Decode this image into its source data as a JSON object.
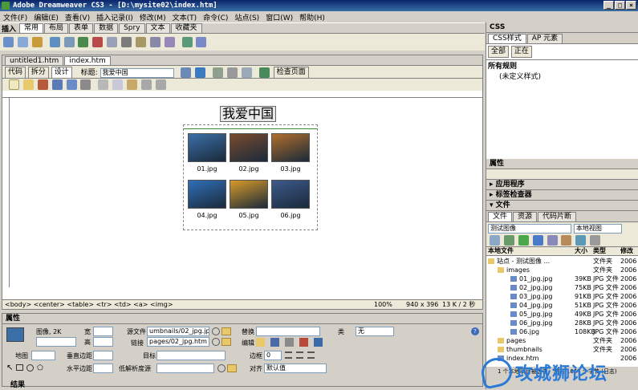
{
  "window": {
    "title": "Adobe Dreamweaver CS3 - [D:\\mysite02\\index.htm]"
  },
  "menu": [
    "文件(F)",
    "编辑(E)",
    "查看(V)",
    "插入记录(I)",
    "修改(M)",
    "文本(T)",
    "命令(C)",
    "站点(S)",
    "窗口(W)",
    "帮助(H)"
  ],
  "insert_bar": {
    "label": "插入",
    "tabs": [
      "常用",
      "布局",
      "表单",
      "数据",
      "Spry",
      "文本",
      "收藏夹"
    ]
  },
  "doc_tabs": [
    "untitled1.htm",
    "index.htm"
  ],
  "doc_toolbar": {
    "code": "代码",
    "split": "拆分",
    "design": "设计",
    "title_label": "标题:",
    "title_value": "我爱中国",
    "check_page": "检查页面"
  },
  "page_heading": "我爱中国",
  "images": [
    {
      "name": "01.jpg",
      "color": "#3b6fa8"
    },
    {
      "name": "02.jpg",
      "color": "#7a4b2e"
    },
    {
      "name": "03.jpg",
      "color": "#b06e2c"
    },
    {
      "name": "04.jpg",
      "color": "#2f6fb9"
    },
    {
      "name": "05.jpg",
      "color": "#d89a2a"
    },
    {
      "name": "06.jpg",
      "color": "#3d5a8c"
    }
  ],
  "status_bar": {
    "tags": "<body> <center> <table> <tr> <td> <a> <img>",
    "zoom": "100%",
    "size": "940 x 396",
    "kb": "13 K / 2 秒"
  },
  "properties": {
    "header": "属性",
    "image_label": "图像, 2K",
    "width_label": "宽",
    "height_label": "高",
    "src_label": "源文件",
    "src_value": "umbnails/02_jpg.jpg",
    "link_label": "链接",
    "link_value": "pages/02_jpg.htm",
    "alt_label": "替换",
    "edit_label": "编辑",
    "class_label": "类",
    "class_value": "无",
    "map_label": "地图",
    "vspace_label": "垂直边距",
    "hspace_label": "水平边距",
    "target_label": "目标",
    "lowsrc_label": "低解析度源",
    "border_label": "边框",
    "border_value": "0",
    "align_label": "对齐",
    "align_value": "默认值"
  },
  "results_label": "结果",
  "css_panel": {
    "header": "CSS",
    "tab1": "CSS样式",
    "tab2": "AP 元素",
    "btn_all": "全部",
    "btn_current": "正在",
    "rules_header": "所有规则",
    "rule_item": "(未定义样式)"
  },
  "attributes_header": "属性",
  "app_panel": "应用程序",
  "tag_inspector": "标签检查器",
  "files_panel": {
    "header": "文件",
    "tabs": [
      "文件",
      "资源",
      "代码片断"
    ],
    "site_select": "测试图像",
    "view_select": "本地视图",
    "columns": [
      "本地文件",
      "大小",
      "类型",
      "修改"
    ],
    "rows": [
      {
        "name": "站点 - 测试图像 ...",
        "size": "",
        "type": "文件夹",
        "mod": "2006"
      },
      {
        "name": "images",
        "size": "",
        "type": "文件夹",
        "mod": "2006"
      },
      {
        "name": "01_jpg.jpg",
        "size": "39KB",
        "type": "JPG 文件",
        "mod": "2006"
      },
      {
        "name": "02_jpg.jpg",
        "size": "75KB",
        "type": "JPG 文件",
        "mod": "2006"
      },
      {
        "name": "03_jpg.jpg",
        "size": "91KB",
        "type": "JPG 文件",
        "mod": "2006"
      },
      {
        "name": "04_jpg.jpg",
        "size": "51KB",
        "type": "JPG 文件",
        "mod": "2006"
      },
      {
        "name": "05_jpg.jpg",
        "size": "49KB",
        "type": "JPG 文件",
        "mod": "2006"
      },
      {
        "name": "06_jpg.jpg",
        "size": "28KB",
        "type": "JPG 文件",
        "mod": "2006"
      },
      {
        "name": "06.jpg",
        "size": "108KB",
        "type": "JPG 文件",
        "mod": "2006"
      },
      {
        "name": "pages",
        "size": "",
        "type": "文件夹",
        "mod": "2006"
      },
      {
        "name": "thumbnails",
        "size": "",
        "type": "文件夹",
        "mod": "2006"
      },
      {
        "name": "index.htm",
        "size": "",
        "type": "",
        "mod": "2006"
      }
    ],
    "status": "1 个本地项目被选中，总共 1667 个字节 (日志)"
  },
  "watermark": "攻城狮论坛"
}
